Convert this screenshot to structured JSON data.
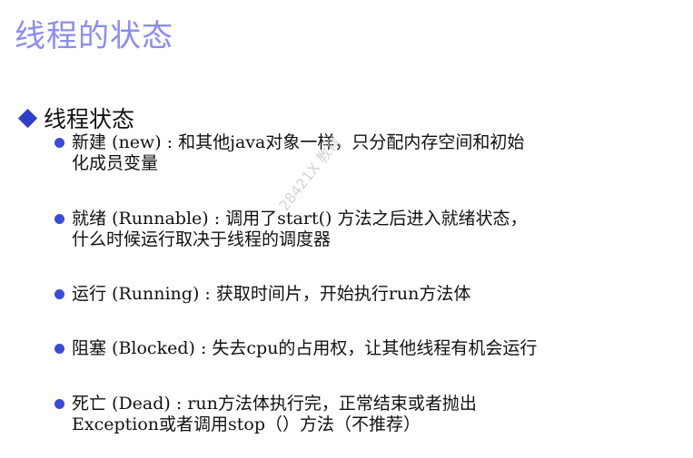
{
  "slide": {
    "title": "线程的状态",
    "heading": "线程状态",
    "items": [
      {
        "line1": "新建 (new) : 和其他java对象一样，只分配内存空间和初始",
        "line2": "化成员变量"
      },
      {
        "line1": "就绪 (Runnable) : 调用了start() 方法之后进入就绪状态，",
        "line2": "什么时候运行取决于线程的调度器"
      },
      {
        "line1": "运行 (Running) : 获取时间片，开始执行run方法体",
        "line2": ""
      },
      {
        "line1": "阻塞 (Blocked) : 失去cpu的占用权，让其他线程有机会运行",
        "line2": ""
      },
      {
        "line1": "死亡 (Dead) :  run方法体执行完，正常结束或者抛出",
        "line2": "Exception或者调用stop（）方法（不推荐）"
      }
    ],
    "watermark": "28421X 教育"
  },
  "colors": {
    "title": "#8c8cf0",
    "bullet": "#3a4bd4",
    "diamond": "#2f3fc8"
  }
}
